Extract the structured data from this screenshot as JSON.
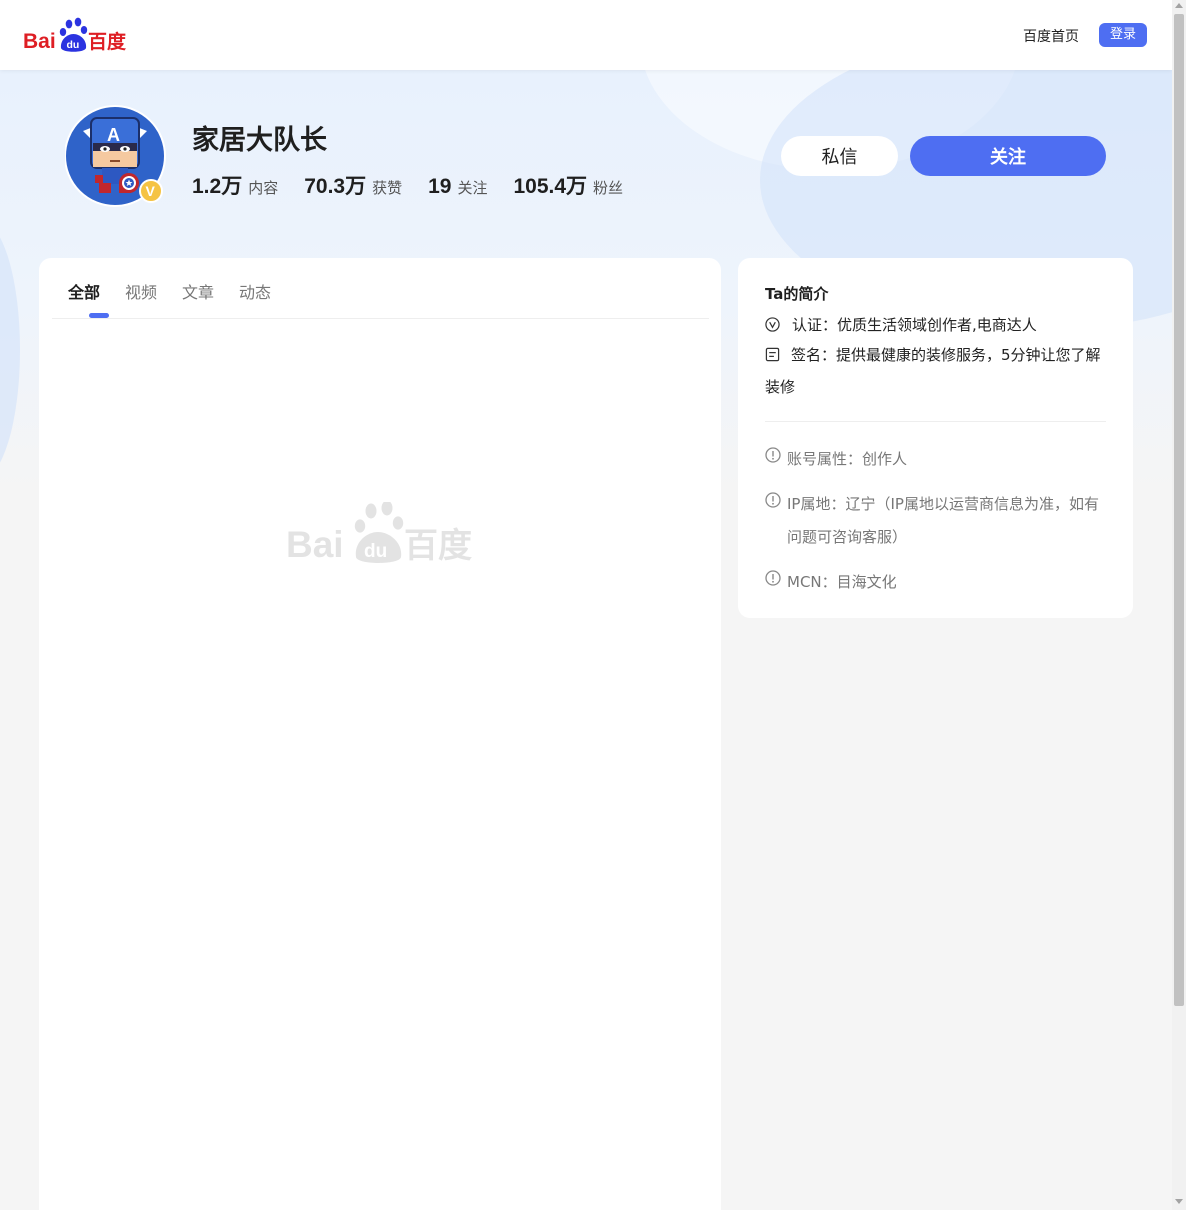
{
  "header": {
    "logo": {
      "text_left": "Bai",
      "text_paw": "du",
      "text_right": "百度"
    },
    "home_link": "百度首页",
    "login_label": "登录"
  },
  "profile": {
    "name": "家居大队长",
    "avatar_icon": "captain-avatar",
    "verified_badge": "V",
    "stats": [
      {
        "num": "1.2万",
        "label": "内容"
      },
      {
        "num": "70.3万",
        "label": "获赞"
      },
      {
        "num": "19",
        "label": "关注"
      },
      {
        "num": "105.4万",
        "label": "粉丝"
      }
    ],
    "message_label": "私信",
    "follow_label": "关注"
  },
  "content": {
    "tabs": [
      {
        "label": "全部",
        "active": true
      },
      {
        "label": "视频",
        "active": false
      },
      {
        "label": "文章",
        "active": false
      },
      {
        "label": "动态",
        "active": false
      }
    ],
    "placeholder": {
      "text_left": "Bai",
      "text_paw": "du",
      "text_right": "百度"
    }
  },
  "intro": {
    "title": "Ta的简介",
    "certification": "认证：优质生活领域创作者,电商达人",
    "signature": "签名：提供最健康的装修服务，5分钟让您了解装修",
    "account_type": "账号属性：创作人",
    "ip_location": "IP属地：辽宁（IP属地以运营商信息为准，如有问题可咨询客服）",
    "mcn": "MCN：目海文化"
  },
  "colors": {
    "accent": "#4e6ef2",
    "brand_red": "#de1e24",
    "brand_blue": "#2b33e0",
    "badge_gold": "#f5c344"
  }
}
